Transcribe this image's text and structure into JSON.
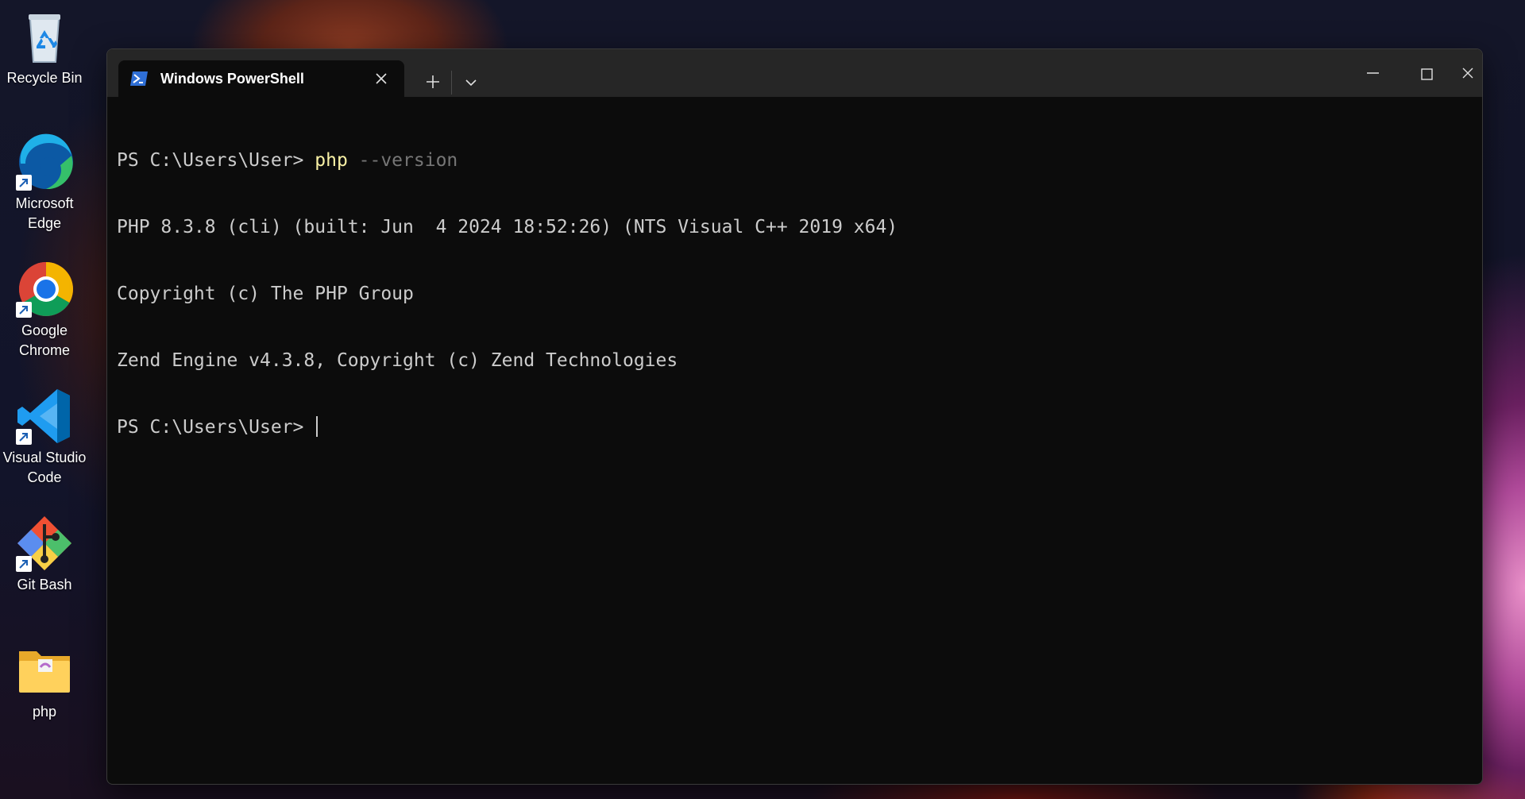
{
  "desktop": {
    "icons": [
      {
        "label": "Recycle Bin",
        "icon": "recycle-bin-icon"
      },
      {
        "label": "Microsoft Edge",
        "icon": "edge-icon"
      },
      {
        "label": "Google Chrome",
        "icon": "chrome-icon"
      },
      {
        "label": "Visual Studio Code",
        "icon": "vscode-icon"
      },
      {
        "label": "Git Bash",
        "icon": "git-bash-icon"
      },
      {
        "label": "php",
        "icon": "folder-icon"
      }
    ]
  },
  "terminal": {
    "tab_title": "Windows PowerShell",
    "lines": {
      "l0_prompt": "PS C:\\Users\\User> ",
      "l0_cmd": "php",
      "l0_arg": " --version",
      "l1": "PHP 8.3.8 (cli) (built: Jun  4 2024 18:52:26) (NTS Visual C++ 2019 x64)",
      "l2": "Copyright (c) The PHP Group",
      "l3": "Zend Engine v4.3.8, Copyright (c) Zend Technologies",
      "l4_prompt": "PS C:\\Users\\User> "
    }
  },
  "colors": {
    "console_bg": "#0c0c0c",
    "console_fg": "#cccccc",
    "command_yellow": "#f9f1a5",
    "parameter_gray": "#767676",
    "titlebar_bg": "#262626"
  }
}
